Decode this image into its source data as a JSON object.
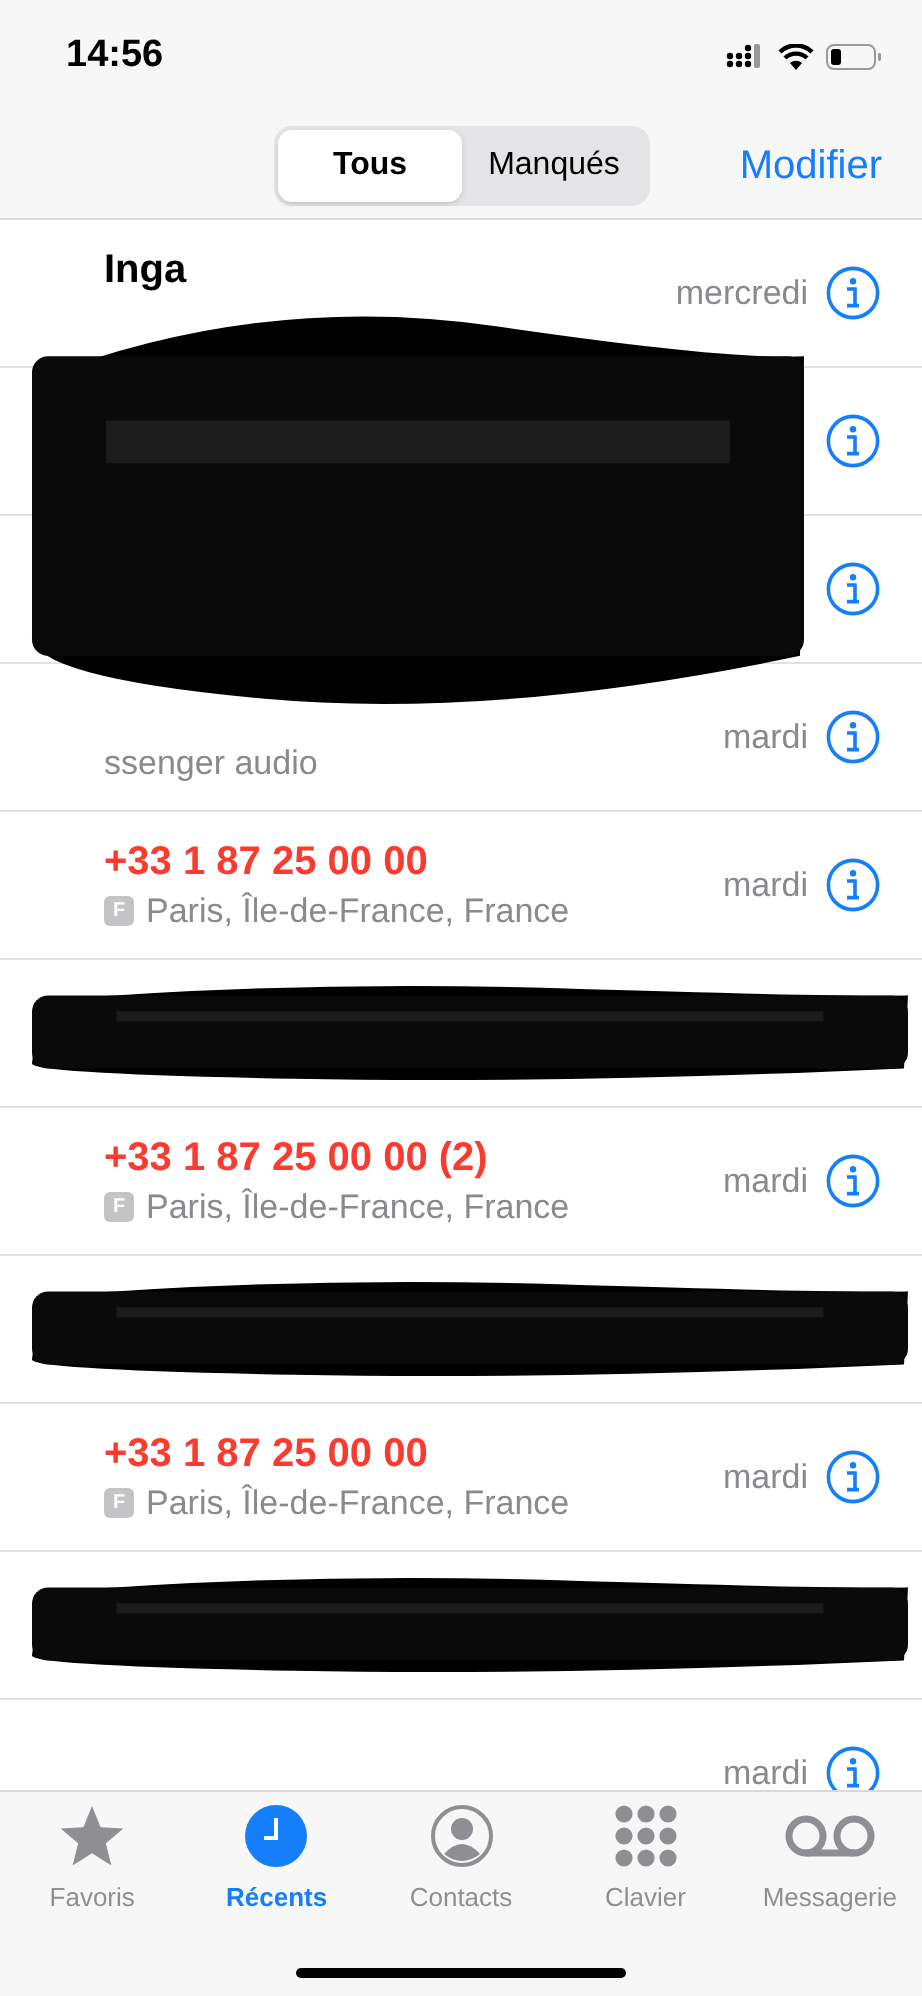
{
  "status_bar": {
    "time": "14:56"
  },
  "segments": [
    {
      "label": "Tous",
      "selected": true
    },
    {
      "label": "Manqués",
      "selected": false
    }
  ],
  "edit_button": "Modifier",
  "calls": [
    {
      "name": "Inga",
      "missed": false,
      "date": "mercredi",
      "info": true,
      "redacted": true
    },
    {
      "info": true,
      "redacted": true
    },
    {
      "info": true,
      "redacted": true
    },
    {
      "detail": "ssenger audio",
      "date": "mardi",
      "info": true,
      "redacted": true
    },
    {
      "name": "+33 1 87 25 00 00",
      "missed": true,
      "badge": "F",
      "detail": "Paris, Île-de-France, France",
      "date": "mardi",
      "info": true,
      "redacted": false
    },
    {
      "info": false,
      "redacted": true
    },
    {
      "name": "+33 1 87 25 00 00 (2)",
      "missed": true,
      "badge": "F",
      "detail": "Paris, Île-de-France, France",
      "date": "mardi",
      "info": true,
      "redacted": false
    },
    {
      "info": false,
      "redacted": true
    },
    {
      "name": "+33 1 87 25 00 00",
      "missed": true,
      "badge": "F",
      "detail": "Paris, Île-de-France, France",
      "date": "mardi",
      "info": true,
      "redacted": false
    },
    {
      "info": false,
      "redacted": true
    },
    {
      "date": "mardi",
      "info": true,
      "redacted": false
    }
  ],
  "tab_bar": [
    {
      "kind": "star",
      "label": "Favoris",
      "selected": false
    },
    {
      "kind": "clock",
      "label": "Récents",
      "selected": true
    },
    {
      "kind": "person",
      "label": "Contacts",
      "selected": false
    },
    {
      "kind": "keypad",
      "label": "Clavier",
      "selected": false
    },
    {
      "kind": "voicemail",
      "label": "Messagerie",
      "selected": false
    }
  ]
}
